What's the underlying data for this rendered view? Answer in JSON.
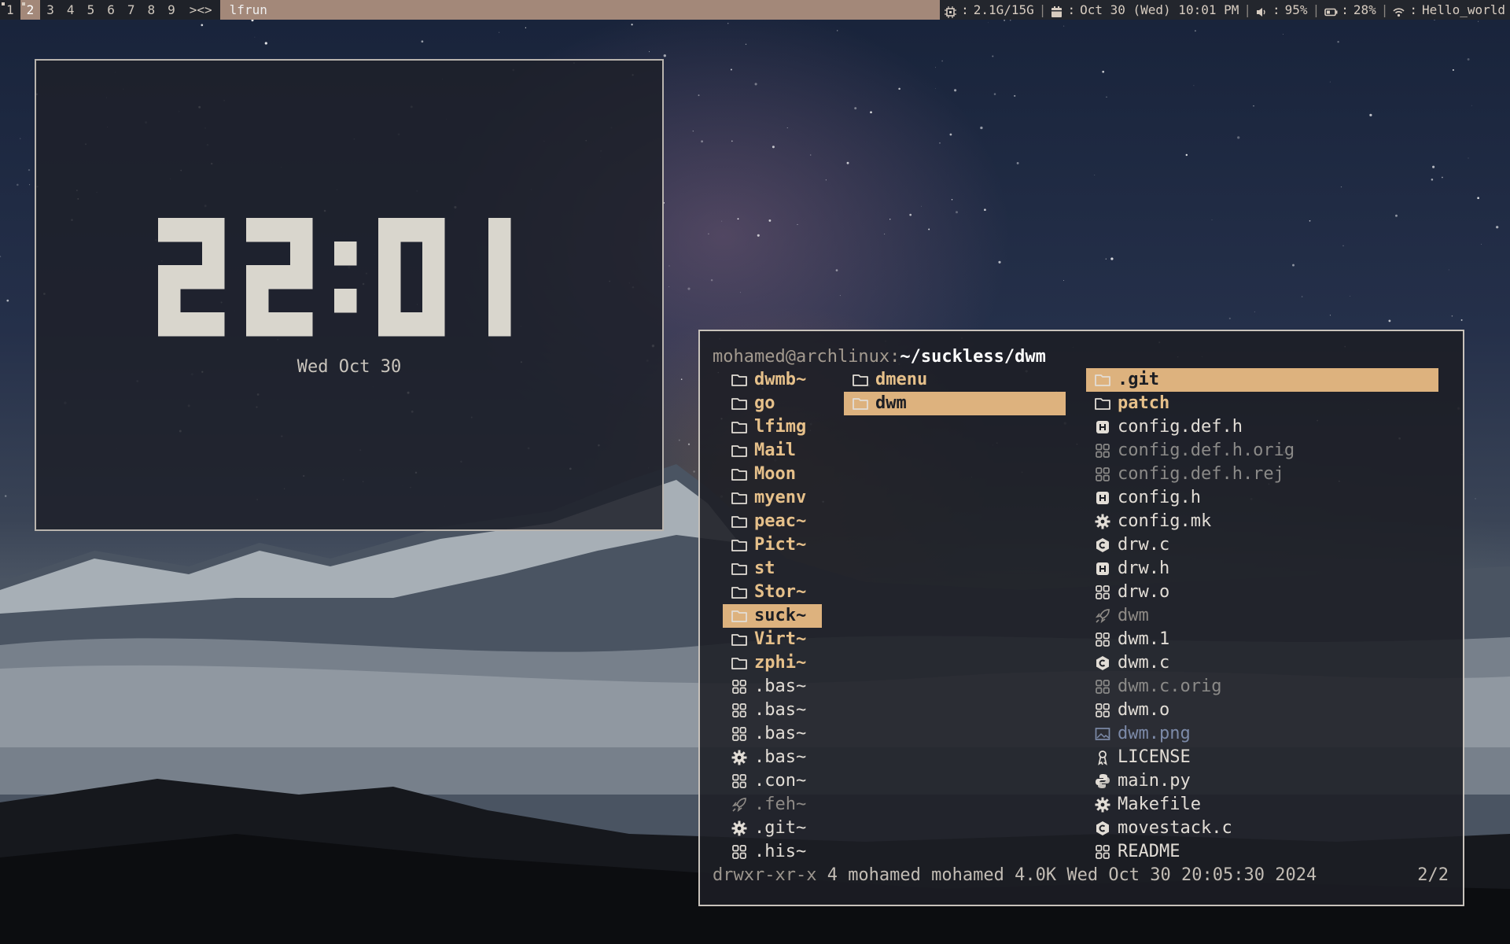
{
  "bar": {
    "tags": [
      {
        "label": "1",
        "active": false,
        "occupied": true
      },
      {
        "label": "2",
        "active": true,
        "occupied": true
      },
      {
        "label": "3",
        "active": false,
        "occupied": false
      },
      {
        "label": "4",
        "active": false,
        "occupied": false
      },
      {
        "label": "5",
        "active": false,
        "occupied": false
      },
      {
        "label": "6",
        "active": false,
        "occupied": false
      },
      {
        "label": "7",
        "active": false,
        "occupied": false
      },
      {
        "label": "8",
        "active": false,
        "occupied": false
      },
      {
        "label": "9",
        "active": false,
        "occupied": false
      }
    ],
    "layout_symbol": "><>",
    "window_title": "lfrun",
    "status": {
      "cpu_icon": "cpu-icon",
      "memory": "2.1G/15G",
      "calendar_icon": "calendar-icon",
      "datetime": "Oct 30 (Wed) 10:01 PM",
      "volume_icon": "volume-icon",
      "volume": "95%",
      "battery_icon": "battery-icon",
      "battery": "28%",
      "wifi_icon": "wifi-icon",
      "network": "Hello_world",
      "separator": "|",
      "label_sep": ":"
    },
    "colors": {
      "accent": "#a38879",
      "bar_bg": "#1f2229"
    }
  },
  "clock": {
    "time": "22:01",
    "date": "Wed Oct 30",
    "digit_color": "#d9d6cd"
  },
  "lf": {
    "path_user_host": "mohamed@archlinux",
    "path_sep": ":",
    "path_dir": "~/suckless/dwm",
    "parent_column": [
      {
        "name": "dwmb~",
        "type": "dir",
        "icon": "folder-icon"
      },
      {
        "name": "go",
        "type": "dir",
        "icon": "folder-icon"
      },
      {
        "name": "lfimg",
        "type": "dir",
        "icon": "folder-icon"
      },
      {
        "name": "Mail",
        "type": "dir",
        "icon": "folder-icon"
      },
      {
        "name": "Moon",
        "type": "dir",
        "icon": "folder-icon"
      },
      {
        "name": "myenv",
        "type": "dir",
        "icon": "folder-icon"
      },
      {
        "name": "peac~",
        "type": "dir",
        "icon": "folder-icon"
      },
      {
        "name": "Pict~",
        "type": "dir",
        "icon": "folder-icon"
      },
      {
        "name": "st",
        "type": "dir",
        "icon": "folder-icon"
      },
      {
        "name": "Stor~",
        "type": "dir",
        "icon": "folder-icon"
      },
      {
        "name": "suck~",
        "type": "dir",
        "icon": "folder-icon",
        "selected": true
      },
      {
        "name": "Virt~",
        "type": "dir",
        "icon": "folder-icon"
      },
      {
        "name": "zphi~",
        "type": "dir",
        "icon": "folder-icon"
      },
      {
        "name": ".bas~",
        "type": "file",
        "icon": "grid-file-icon"
      },
      {
        "name": ".bas~",
        "type": "file",
        "icon": "grid-file-icon"
      },
      {
        "name": ".bas~",
        "type": "file",
        "icon": "grid-file-icon"
      },
      {
        "name": ".bas~",
        "type": "file",
        "icon": "gear-icon"
      },
      {
        "name": ".con~",
        "type": "file",
        "icon": "grid-file-icon"
      },
      {
        "name": ".feh~",
        "type": "exec",
        "icon": "rocket-icon"
      },
      {
        "name": ".git~",
        "type": "file",
        "icon": "gear-icon"
      },
      {
        "name": ".his~",
        "type": "file",
        "icon": "grid-file-icon"
      }
    ],
    "current_column": [
      {
        "name": "dmenu",
        "type": "dir",
        "icon": "folder-icon"
      },
      {
        "name": "dwm",
        "type": "dir",
        "icon": "folder-icon",
        "selected": true
      }
    ],
    "preview_column": [
      {
        "name": ".git",
        "type": "dir",
        "icon": "folder-icon",
        "selected": true
      },
      {
        "name": "patch",
        "type": "dir",
        "icon": "folder-icon"
      },
      {
        "name": "config.def.h",
        "type": "file",
        "icon": "h-file-icon"
      },
      {
        "name": "config.def.h.orig",
        "type": "dim",
        "icon": "grid-file-icon"
      },
      {
        "name": "config.def.h.rej",
        "type": "dim",
        "icon": "grid-file-icon"
      },
      {
        "name": "config.h",
        "type": "file",
        "icon": "h-file-icon"
      },
      {
        "name": "config.mk",
        "type": "file",
        "icon": "gear-icon"
      },
      {
        "name": "drw.c",
        "type": "file",
        "icon": "c-file-icon"
      },
      {
        "name": "drw.h",
        "type": "file",
        "icon": "h-file-icon"
      },
      {
        "name": "drw.o",
        "type": "file",
        "icon": "grid-file-icon"
      },
      {
        "name": "dwm",
        "type": "exec",
        "icon": "rocket-icon"
      },
      {
        "name": "dwm.1",
        "type": "file",
        "icon": "grid-file-icon"
      },
      {
        "name": "dwm.c",
        "type": "file",
        "icon": "c-file-icon"
      },
      {
        "name": "dwm.c.orig",
        "type": "dim",
        "icon": "grid-file-icon"
      },
      {
        "name": "dwm.o",
        "type": "file",
        "icon": "grid-file-icon"
      },
      {
        "name": "dwm.png",
        "type": "img",
        "icon": "image-icon"
      },
      {
        "name": "LICENSE",
        "type": "file",
        "icon": "license-icon"
      },
      {
        "name": "main.py",
        "type": "file",
        "icon": "python-icon"
      },
      {
        "name": "Makefile",
        "type": "file",
        "icon": "gear-icon"
      },
      {
        "name": "movestack.c",
        "type": "file",
        "icon": "c-file-icon"
      },
      {
        "name": "README",
        "type": "file",
        "icon": "grid-file-icon"
      }
    ],
    "status_info": "drwxr-xr-x 4 mohamed mohamed 4.0K Wed Oct 30 20:05:30 2024",
    "status_perm": "drwxr-xr-x",
    "status_rest": " 4 mohamed mohamed 4.0K Wed Oct 30 20:05:30 2024",
    "position": "2/2",
    "colors": {
      "dir": "#e6c08a",
      "selection": "#ddb27e",
      "image": "#7c8aa8"
    }
  }
}
